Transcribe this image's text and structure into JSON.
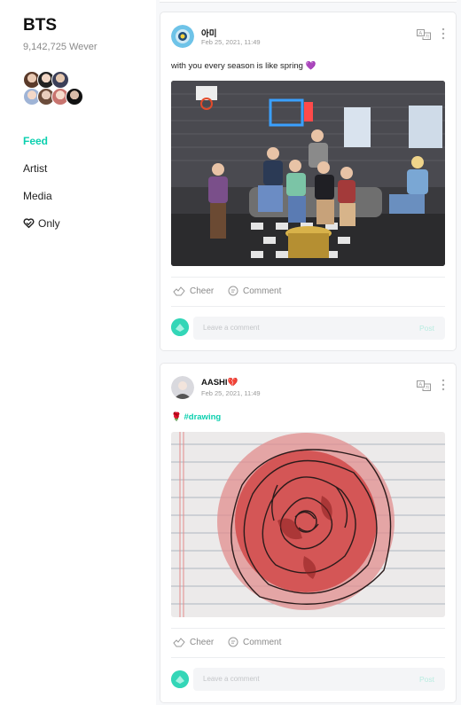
{
  "sidebar": {
    "community_name": "BTS",
    "member_count": "9,142,725 Wever",
    "nav": [
      {
        "label": "Feed",
        "active": true
      },
      {
        "label": "Artist"
      },
      {
        "label": "Media"
      },
      {
        "label": "Only",
        "icon": "heart-check-icon"
      }
    ]
  },
  "posts": [
    {
      "author": "아미",
      "date": "Feb 25, 2021, 11:49",
      "text": "with you every season is like spring 💜",
      "image": "group-photo-in-loft-studio",
      "actions": {
        "cheer": "Cheer",
        "comment": "Comment"
      },
      "comment_placeholder": "Leave a comment",
      "comment_post": "Post"
    },
    {
      "author": "AASHI💔",
      "date": "Feb 25, 2021, 11:49",
      "text_prefix": "🌹",
      "hashtag": "#drawing",
      "image": "red-rose-ink-drawing-on-lined-paper",
      "actions": {
        "cheer": "Cheer",
        "comment": "Comment"
      },
      "comment_placeholder": "Leave a comment",
      "comment_post": "Post"
    }
  ],
  "colors": {
    "accent": "#0bd0af",
    "text": "#222222",
    "muted": "#8a8a8a",
    "background": "#f7f8fa"
  }
}
